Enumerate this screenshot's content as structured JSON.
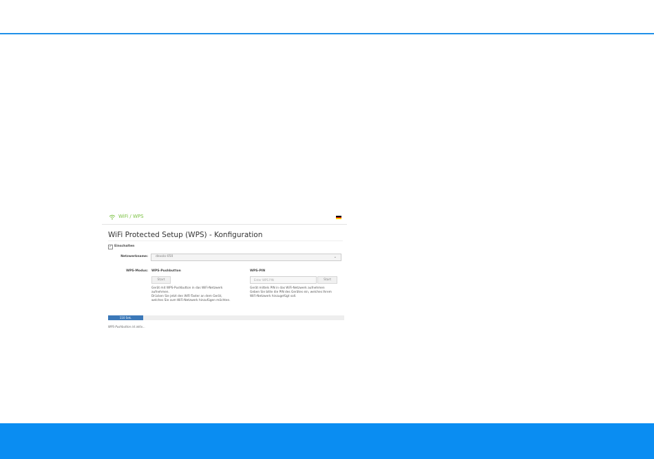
{
  "header": {
    "accent_color": "#1e90e8"
  },
  "breadcrumb": {
    "text": "WiFi / WPS",
    "color": "#7ac142",
    "icon": "wifi-icon"
  },
  "language": {
    "icon": "german-flag-icon"
  },
  "page": {
    "title": "WiFi Protected Setup (WPS) - Konfiguration"
  },
  "enable": {
    "label": "Einschalten",
    "checked": true
  },
  "network": {
    "label": "Netzwerkname:",
    "value": "devolo-050"
  },
  "wps_mode": {
    "label": "WPS-Modus:",
    "pushbutton": {
      "heading": "WPS-Pushbutton",
      "button": "Start",
      "description": [
        "Gerät mit WPS-Pushbutton in das WiFi-Netzwerk",
        "aufnehmen.",
        "Drücken Sie jetzt den WiFi-Taster an dem Gerät,",
        "welches Sie zum WiFi-Netzwerk hinzufügen möchten."
      ]
    },
    "pin": {
      "heading": "WPS-PIN",
      "placeholder": "Enter WPS PIN",
      "button": "Start",
      "description": [
        "Gerät mittels PIN in das WiFi-Netzwerk aufnehmen",
        "Geben Sie bitte die PIN des Gerätes ein, welches Ihrem",
        "WiFi-Netzwerk hinzugefügt soll."
      ]
    }
  },
  "progress": {
    "label": "110 Sek.",
    "fraction": 0.15,
    "color": "#3b78b8"
  },
  "status": {
    "text": "WPS-Pushbutton ist aktiv..."
  },
  "footer": {
    "color": "#0a8df2"
  }
}
